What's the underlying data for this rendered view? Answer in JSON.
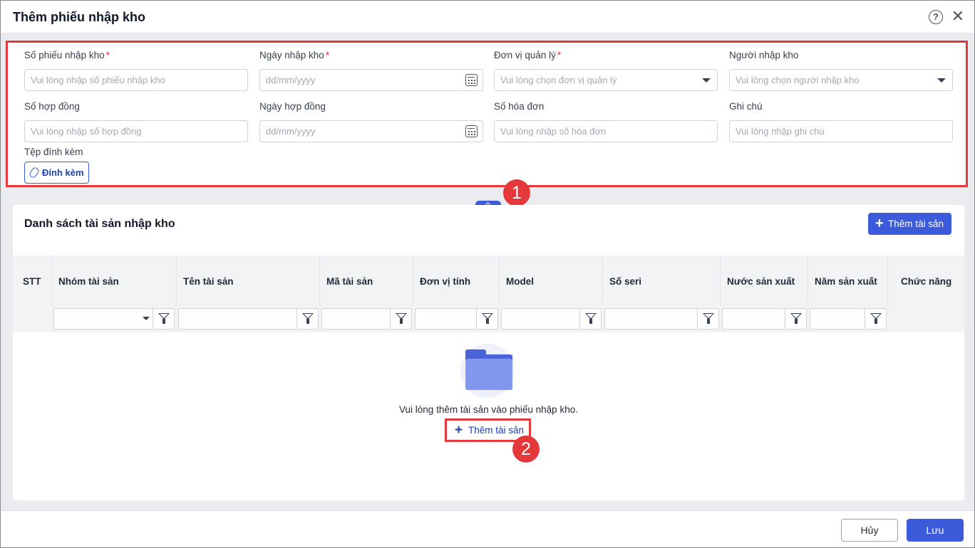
{
  "dialog": {
    "title": "Thêm phiếu nhập kho",
    "help_glyph": "?",
    "close_glyph": "✕"
  },
  "form": {
    "required_mark": "*",
    "receipt_no": {
      "label": "Số phiếu nhập kho",
      "placeholder": "Vui lòng nhập số phiếu nhập kho"
    },
    "receipt_date": {
      "label": "Ngày nhập kho",
      "placeholder": "dd/mm/yyyy"
    },
    "managing_unit": {
      "label": "Đơn vị quản lý",
      "placeholder": "Vui lòng chọn đơn vị quản lý"
    },
    "receiver": {
      "label": "Người nhập kho",
      "placeholder": "Vui lòng chọn người nhập kho"
    },
    "contract_no": {
      "label": "Số hợp đồng",
      "placeholder": "Vui lòng nhập số hợp đồng"
    },
    "contract_date": {
      "label": "Ngày hợp đồng",
      "placeholder": "dd/mm/yyyy"
    },
    "invoice_no": {
      "label": "Số hóa đơn",
      "placeholder": "Vui lòng nhập số hóa đơn"
    },
    "note": {
      "label": "Ghi chú",
      "placeholder": "Vui lòng nhập ghi chú"
    },
    "attachment": {
      "label": "Tệp đính kèm",
      "button": "Đính kèm"
    }
  },
  "annotations": {
    "badge1": "1",
    "badge2": "2"
  },
  "assets": {
    "title": "Danh sách tài sản nhập kho",
    "add_button": "Thêm tài sản",
    "columns": [
      "STT",
      "Nhóm tài sản",
      "Tên tài sản",
      "Mã tài sản",
      "Đơn vị tính",
      "Model",
      "Số seri",
      "Nước sản xuất",
      "Năm sản xuất",
      "Chức năng"
    ],
    "empty_message": "Vui lòng thêm tài sản vào phiếu nhập kho.",
    "empty_add_link": "Thêm tài sản"
  },
  "footer": {
    "cancel": "Hủy",
    "save": "Lưu"
  },
  "colors": {
    "primary": "#3b5bdb",
    "annotation": "#e5383b"
  }
}
